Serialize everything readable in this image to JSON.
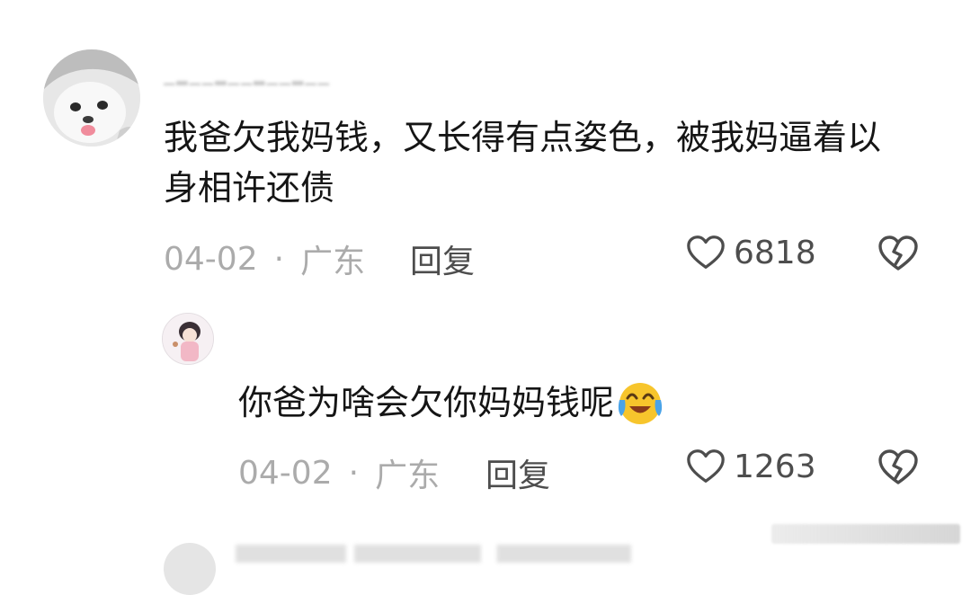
{
  "comment": {
    "text": "我爸欠我妈钱，又长得有点姿色，被我妈逼着以身相许还债",
    "date": "04-02",
    "separator": "·",
    "location": "广东",
    "reply_label": "回复",
    "likes": "6818"
  },
  "reply": {
    "text": "你爸为啥会欠你妈妈钱呢",
    "emoji_icon": "laugh-cry-emoji-icon",
    "date": "04-02",
    "separator": "·",
    "location": "广东",
    "reply_label": "回复",
    "likes": "1263"
  },
  "icons": {
    "like": "heart-outline-icon",
    "dislike": "broken-heart-icon"
  },
  "colors": {
    "meta_gray": "#ababab",
    "text_dark": "#151515",
    "icon_gray": "#4d4d4d"
  }
}
